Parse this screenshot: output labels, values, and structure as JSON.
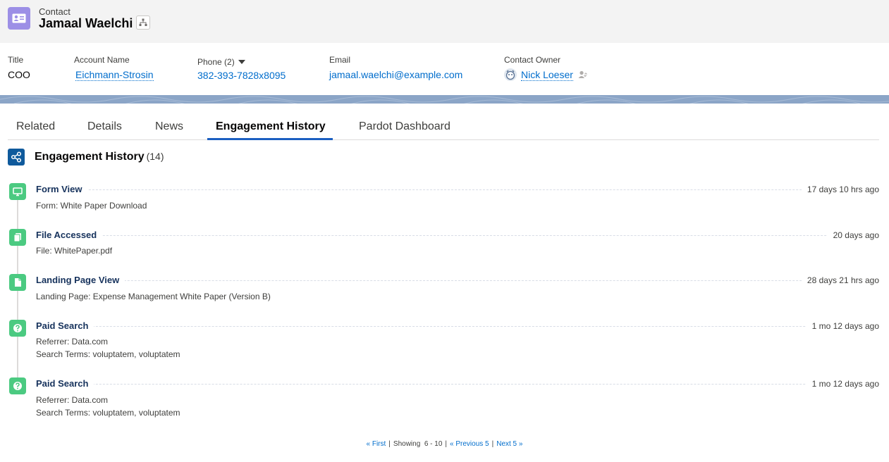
{
  "header": {
    "object_type": "Contact",
    "record_name": "Jamaal Waelchi",
    "icon": "contact-card-icon",
    "accent": "#9c8fe6"
  },
  "highlights": {
    "title_label": "Title",
    "title_value": "COO",
    "account_label": "Account Name",
    "account_value": "Eichmann-Strosin",
    "phone_label": "Phone (2)",
    "phone_value": "382-393-7828x8095",
    "email_label": "Email",
    "email_value": "jamaal.waelchi@example.com",
    "owner_label": "Contact Owner",
    "owner_value": "Nick Loeser"
  },
  "tabs": [
    {
      "label": "Related"
    },
    {
      "label": "Details"
    },
    {
      "label": "News"
    },
    {
      "label": "Engagement History",
      "active": true
    },
    {
      "label": "Pardot Dashboard"
    }
  ],
  "card": {
    "title": "Engagement History",
    "count": "(14)"
  },
  "items": [
    {
      "title": "Form View",
      "time": "17 days 10 hrs ago",
      "icon": "monitor-icon",
      "lines": [
        "Form: White Paper Download"
      ]
    },
    {
      "title": "File Accessed",
      "time": "20 days ago",
      "icon": "files-icon",
      "lines": [
        "File: WhitePaper.pdf"
      ]
    },
    {
      "title": "Landing Page View",
      "time": "28 days 21 hrs ago",
      "icon": "page-icon",
      "lines": [
        "Landing Page: Expense Management White Paper (Version B)"
      ]
    },
    {
      "title": "Paid Search",
      "time": "1 mo 12 days ago",
      "icon": "question-icon",
      "lines": [
        "Referrer: Data.com",
        "Search Terms: voluptatem, voluptatem"
      ]
    },
    {
      "title": "Paid Search",
      "time": "1 mo 12 days ago",
      "icon": "question-icon",
      "lines": [
        "Referrer: Data.com",
        "Search Terms: voluptatem, voluptatem"
      ]
    }
  ],
  "pager": {
    "first": "« First",
    "showing": "Showing",
    "range": "6 - 10",
    "previous": "« Previous 5",
    "next": "Next 5 »"
  }
}
